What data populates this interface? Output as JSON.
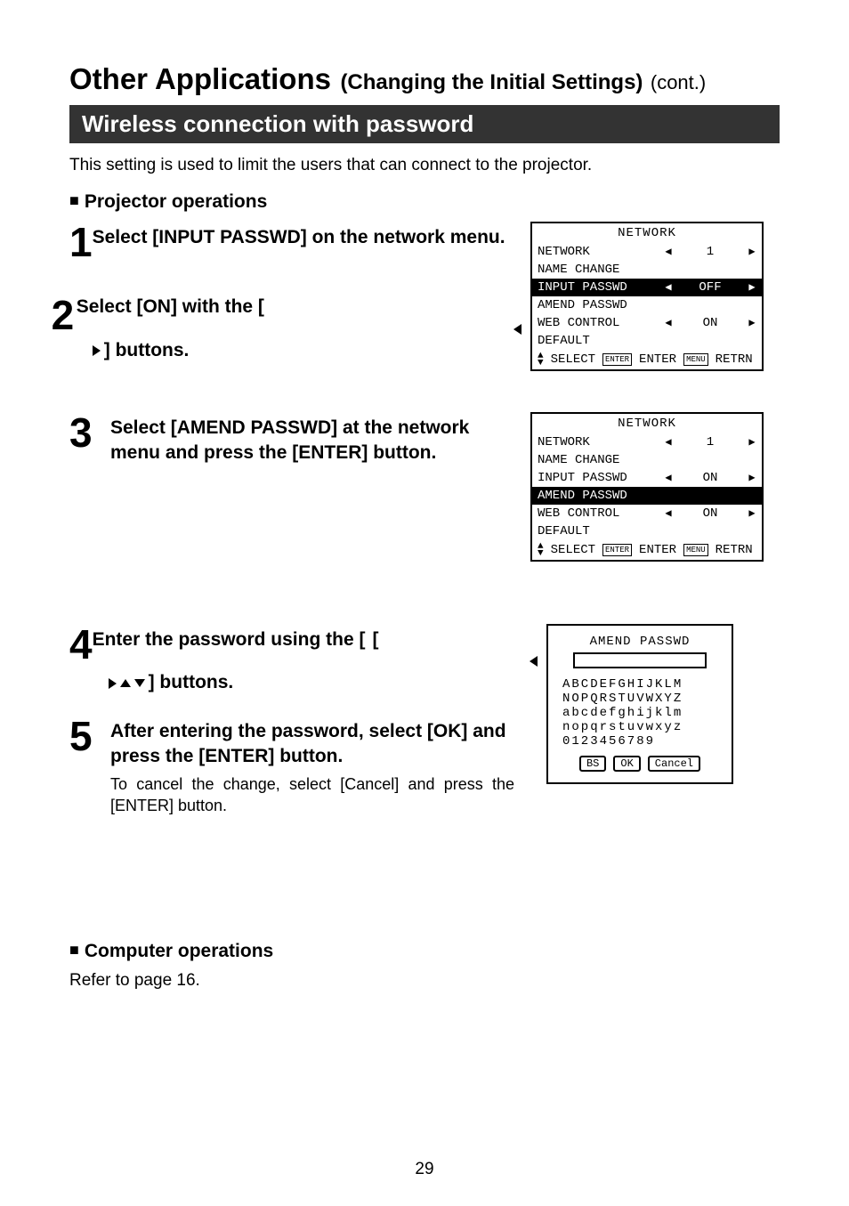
{
  "page": {
    "title_main": "Other Applications",
    "title_sub": "(Changing the Initial Settings)",
    "title_cont": "(cont.)",
    "section_bar": "Wireless connection with password",
    "intro": "This setting is used to limit the users that can connect to the projector.",
    "sub_projector": "Projector operations",
    "sub_computer": "Computer operations",
    "computer_body": "Refer to page 16.",
    "page_number": "29"
  },
  "steps": {
    "s1": {
      "num": "1",
      "text": "Select [INPUT PASSWD] on the network menu."
    },
    "s2": {
      "num": "2",
      "text_before": "Select [ON] with the [",
      "text_after": "] buttons."
    },
    "s3": {
      "num": "3",
      "text": "Select [AMEND PASSWD] at the network menu and press the [ENTER] button."
    },
    "s4": {
      "num": "4",
      "text_before": "Enter the password using the [",
      "text_after": "] buttons."
    },
    "s5": {
      "num": "5",
      "text": "After entering the password, select [OK] and press the [ENTER] button.",
      "body": "To cancel the change, select [Cancel] and press the [ENTER] button."
    }
  },
  "menu1": {
    "title": "NETWORK",
    "rows": [
      {
        "label": "NETWORK",
        "left": true,
        "value": "1",
        "right": true,
        "sel": false
      },
      {
        "label": "NAME CHANGE",
        "left": false,
        "value": "",
        "right": false,
        "sel": false
      },
      {
        "label": "INPUT PASSWD",
        "left": true,
        "value": "OFF",
        "right": true,
        "sel": true
      },
      {
        "label": "AMEND PASSWD",
        "left": false,
        "value": "",
        "right": false,
        "sel": false
      },
      {
        "label": "WEB CONTROL",
        "left": true,
        "value": "ON",
        "right": true,
        "sel": false
      },
      {
        "label": "DEFAULT",
        "left": false,
        "value": "",
        "right": false,
        "sel": false
      }
    ],
    "foot": {
      "select": "SELECT",
      "enter_badge": "ENTER",
      "enter": "ENTER",
      "retrn_badge": "MENU",
      "retrn": "RETRN"
    }
  },
  "menu2": {
    "title": "NETWORK",
    "rows": [
      {
        "label": "NETWORK",
        "left": true,
        "value": "1",
        "right": true,
        "sel": false
      },
      {
        "label": "NAME CHANGE",
        "left": false,
        "value": "",
        "right": false,
        "sel": false
      },
      {
        "label": "INPUT PASSWD",
        "left": true,
        "value": "ON",
        "right": true,
        "sel": false
      },
      {
        "label": "AMEND PASSWD",
        "left": false,
        "value": "",
        "right": false,
        "sel": true
      },
      {
        "label": "WEB CONTROL",
        "left": true,
        "value": "ON",
        "right": true,
        "sel": false
      },
      {
        "label": "DEFAULT",
        "left": false,
        "value": "",
        "right": false,
        "sel": false
      }
    ],
    "foot": {
      "select": "SELECT",
      "enter_badge": "ENTER",
      "enter": "ENTER",
      "retrn_badge": "MENU",
      "retrn": "RETRN"
    }
  },
  "pwbox": {
    "title": "AMEND PASSWD",
    "lines": [
      "ABCDEFGHIJKLM",
      "NOPQRSTUVWXYZ",
      "abcdefghijklm",
      "nopqrstuvwxyz",
      "0123456789"
    ],
    "buttons": [
      "BS",
      "OK",
      "Cancel"
    ]
  }
}
